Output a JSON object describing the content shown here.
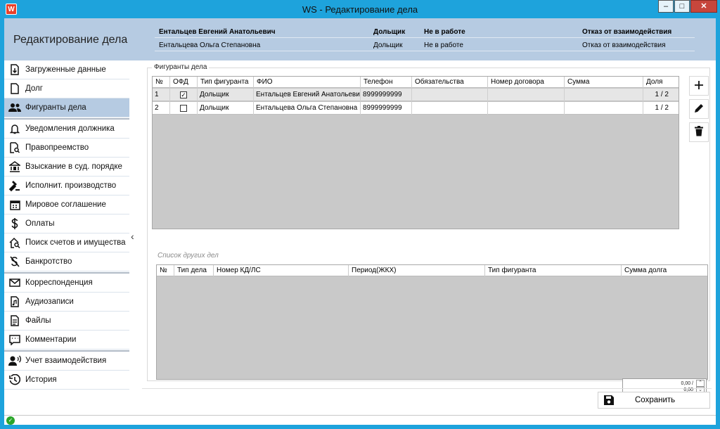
{
  "window": {
    "title": "WS - Редактирование дела",
    "app_icon_letter": "W",
    "controls": {
      "minimize": "–",
      "maximize": "□",
      "close": "✕"
    }
  },
  "header": {
    "page_title": "Редактирование дела",
    "rows": [
      {
        "name": "Ентальцев Евгений Анатольевич",
        "role": "Дольщик",
        "status": "Не в работе",
        "interaction": "Отказ от взаимодействия"
      },
      {
        "name": "Ентальцева Ольга Степановна",
        "role": "Дольщик",
        "status": "Не в работе",
        "interaction": "Отказ от взаимодействия"
      }
    ]
  },
  "sidebar": {
    "active_index": 2,
    "items": [
      {
        "label": "Загруженные данные",
        "icon": "file-download-icon"
      },
      {
        "label": "Долг",
        "icon": "document-icon"
      },
      {
        "label": "Фигуранты дела",
        "icon": "people-icon"
      },
      {
        "label": "Уведомления должника",
        "icon": "bell-icon"
      },
      {
        "label": "Правопреемство",
        "icon": "document-search-icon"
      },
      {
        "label": "Взыскание в суд. порядке",
        "icon": "court-icon"
      },
      {
        "label": "Исполнит. производство",
        "icon": "gavel-icon"
      },
      {
        "label": "Мировое соглашение",
        "icon": "calendar-icon"
      },
      {
        "label": "Оплаты",
        "icon": "dollar-icon"
      },
      {
        "label": "Поиск счетов и имущества",
        "icon": "house-search-icon"
      },
      {
        "label": "Банкротство",
        "icon": "no-dollar-icon"
      },
      {
        "label": "Корреспонденция",
        "icon": "mail-icon"
      },
      {
        "label": "Аудиозаписи",
        "icon": "audio-file-icon"
      },
      {
        "label": "Файлы",
        "icon": "file-text-icon"
      },
      {
        "label": "Комментарии",
        "icon": "comment-icon"
      },
      {
        "label": "Учет взаимодействия",
        "icon": "person-voice-icon"
      },
      {
        "label": "История",
        "icon": "history-icon"
      }
    ],
    "collapse_glyph": "‹"
  },
  "participants": {
    "group_label": "Фигуранты дела",
    "columns": [
      "№",
      "ОФД",
      "Тип фигуранта",
      "ФИО",
      "Телефон",
      "Обязательства",
      "Номер договора",
      "Сумма",
      "Доля"
    ],
    "rows": [
      {
        "num": "1",
        "ofd": true,
        "type": "Дольщик",
        "fio": "Ентальцев Евгений Анатольевич",
        "phone": "8999999999",
        "obligations": "",
        "contract": "",
        "sum": "",
        "share": "1 / 2"
      },
      {
        "num": "2",
        "ofd": false,
        "type": "Дольщик",
        "fio": "Ентальцева Ольга Степановна",
        "phone": "8999999999",
        "obligations": "",
        "contract": "",
        "sum": "",
        "share": "1 / 2"
      }
    ],
    "check_glyph": "✓"
  },
  "other_cases": {
    "label": "Список других дел",
    "columns": [
      "№",
      "Тип дела",
      "Номер КД/ЛС",
      "Период(ЖКХ)",
      "Тип фигуранта",
      "Сумма долга"
    ]
  },
  "totals": {
    "line1": "0,00 /",
    "line2": "0,00",
    "spin_up": "⌃",
    "spin_down": "⌄"
  },
  "actions": {
    "save_label": "Сохранить"
  },
  "status": {
    "ok_glyph": "✓"
  },
  "colors": {
    "titlebar": "#1ea3dc",
    "header_band": "#b6cbe2",
    "grid_empty": "#c9c9c9",
    "status_ok": "#2aa52a",
    "close_button": "#c7463c"
  }
}
